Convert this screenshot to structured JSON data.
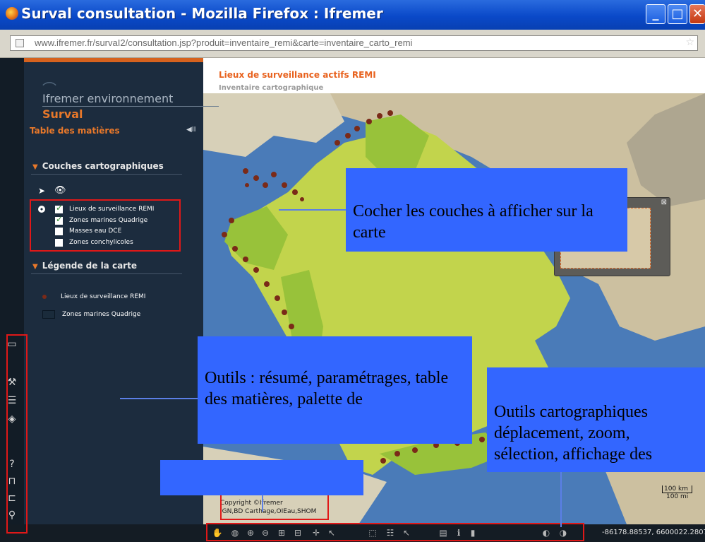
{
  "window": {
    "title": "Surval consultation - Mozilla Firefox : Ifremer",
    "minimize_label": "_",
    "maximize_label": "□",
    "close_label": "✕"
  },
  "urlbar": {
    "url": "www.ifremer.fr/survaI2/consultation.jsp?produit=inventaire_remi&carte=inventaire_carto_remi"
  },
  "sidebar": {
    "brand": "Ifremer environnement",
    "app_name": "Surval",
    "toc_title": "Table des matières",
    "layers_heading": "Couches cartographiques",
    "layers": [
      {
        "label": "Lieux de surveillance REMI",
        "checked": true,
        "active": true
      },
      {
        "label": "Zones marines Quadrige",
        "checked": true,
        "active": false
      },
      {
        "label": "Masses eau DCE",
        "checked": false,
        "active": false
      },
      {
        "label": "Zones conchylicoles",
        "checked": false,
        "active": false
      }
    ],
    "legend_heading": "Légende de la carte",
    "legend": [
      {
        "label": "Lieux de surveillance REMI"
      },
      {
        "label": "Zones marines Quadrige"
      }
    ]
  },
  "map": {
    "title": "Lieux de surveillance actifs REMI",
    "subtitle": "Inventaire cartographique",
    "copyright_line1": "Copyright ©Ifremer",
    "copyright_line2": "IGN,BD Carthage,OIEau,SHOM",
    "scale_km": "100 km",
    "scale_mi": "100 mi",
    "coords": "-86178.88537, 6600022.2807"
  },
  "callouts": {
    "layers": "Cocher les couches à afficher sur la carte",
    "tools": "Outils : résumé, paramétrages, table des matières, palette de",
    "carto": "Outils cartographiques déplacement, zoom, sélection, affichage des"
  },
  "colors": {
    "accent_orange": "#e8782a",
    "callout_blue": "#3366ff",
    "highlight_red": "#e01818",
    "sea": "#4a7bb8",
    "land_green": "#c2d44c",
    "site_dot": "#7a2a18"
  }
}
